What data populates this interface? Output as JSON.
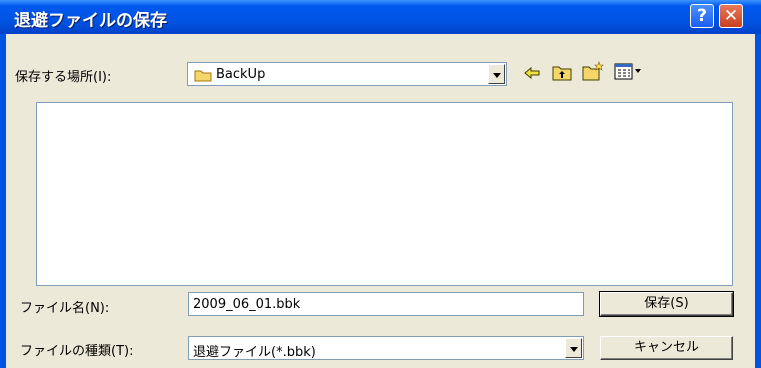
{
  "window": {
    "title": "退避ファイルの保存",
    "help_label": "?",
    "close_label": "✕"
  },
  "save_in": {
    "label": "保存する場所(I):",
    "value": "BackUp",
    "folder_icon": "folder-icon"
  },
  "toolbar": {
    "icons": [
      "back-arrow-icon",
      "up-folder-icon",
      "new-folder-icon",
      "view-menu-icon"
    ]
  },
  "filename": {
    "label": "ファイル名(N):",
    "value": "2009_06_01.bbk"
  },
  "filetype": {
    "label": "ファイルの種類(T):",
    "value": "退避ファイル(*.bbk)"
  },
  "buttons": {
    "save": "保存(S)",
    "cancel": "キャンセル"
  }
}
